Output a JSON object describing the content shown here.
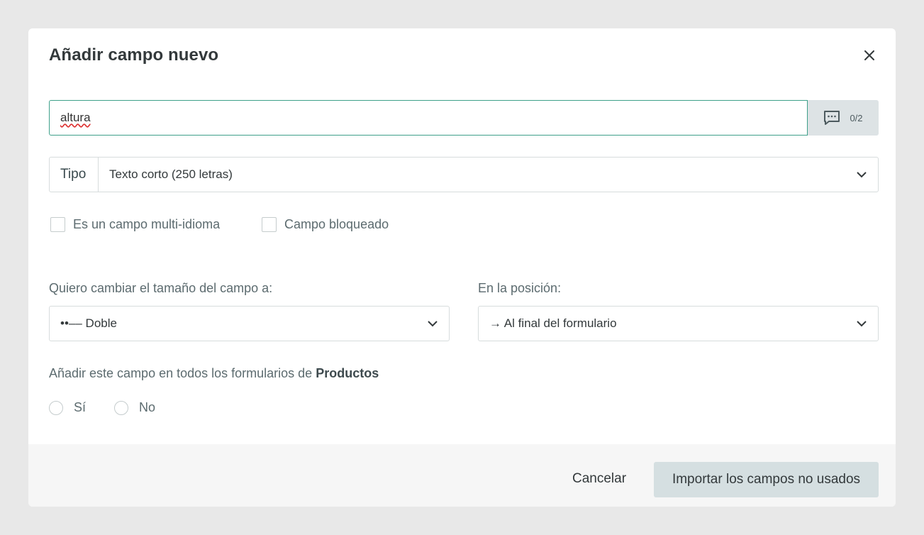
{
  "modal": {
    "title": "Añadir campo nuevo",
    "close_icon": "close-icon"
  },
  "name_field": {
    "value": "altura",
    "translations_icon": "comment-icon",
    "translations_count": "0/2"
  },
  "type_field": {
    "label": "Tipo",
    "value": "Texto corto (250 letras)"
  },
  "options": {
    "multilang_label": "Es un campo multi-idioma",
    "multilang_checked": false,
    "locked_label": "Campo bloqueado",
    "locked_checked": false
  },
  "size_field": {
    "label": "Quiero cambiar el tamaño del campo a:",
    "value": "••–– Doble"
  },
  "position_field": {
    "label": "En la posición:",
    "value": "→ Al final del formulario"
  },
  "all_forms": {
    "text": "Añadir este campo en todos los formularios de ",
    "entity": "Productos",
    "yes_label": "Sí",
    "no_label": "No"
  },
  "footer": {
    "cancel_label": "Cancelar",
    "import_label": "Importar los campos no usados"
  },
  "colors": {
    "accent_border": "#3ea08a",
    "primary_button": "#d5dfe1",
    "background": "#e8e8e8"
  }
}
